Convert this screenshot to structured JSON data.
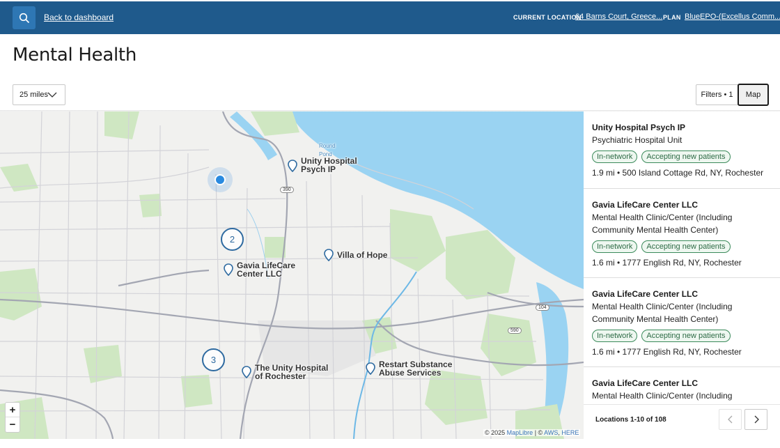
{
  "header": {
    "back_label": "Back to dashboard",
    "current_location_label": "CURRENT LOCATION",
    "current_location_value": "64 Barns Court, Greece...",
    "plan_label": "PLAN",
    "plan_value": "BlueEPO-(Excellus Comm..."
  },
  "page": {
    "title": "Mental Health"
  },
  "controls": {
    "radius": "25 miles",
    "filters": "Filters • 1",
    "map": "Map"
  },
  "map": {
    "labels": {
      "unity_psych": "Unity Hospital Psych IP",
      "villa_hope": "Villa of Hope",
      "gavia": "Gavia LifeCare Center LLC",
      "unity_rochester": "The Unity Hospital of Rochester",
      "restart": "Restart Substance Abuse Services",
      "round_pond": "Round Pond"
    },
    "clusters": [
      "2",
      "3"
    ],
    "shields": [
      "390",
      "104",
      "590"
    ],
    "zoom_in": "+",
    "zoom_out": "−",
    "attribution_a": "© 2025 ",
    "attribution_maplibre": "MapLibre",
    "attribution_b": " | © ",
    "attribution_aws": "AWS",
    "attribution_c": ", ",
    "attribution_here": "HERE",
    "colors": {
      "water": "#9ad3f2",
      "park": "#cfe7c2",
      "road": "#c9c9cf",
      "highway": "#9fa1ad"
    }
  },
  "results": [
    {
      "name": "Unity Hospital Psych IP",
      "type": "Psychiatric Hospital Unit",
      "badges": [
        "In-network",
        "Accepting new patients"
      ],
      "address": "1.9 mi • 500 Island Cottage Rd, NY, Rochester"
    },
    {
      "name": "Gavia LifeCare Center LLC",
      "type": "Mental Health Clinic/Center (Including Community Mental Health Center)",
      "badges": [
        "In-network",
        "Accepting new patients"
      ],
      "address": "1.6 mi • 1777 English Rd, NY, Rochester"
    },
    {
      "name": "Gavia LifeCare Center LLC",
      "type": "Mental Health Clinic/Center (Including Community Mental Health Center)",
      "badges": [
        "In-network",
        "Accepting new patients"
      ],
      "address": "1.6 mi • 1777 English Rd, NY, Rochester"
    },
    {
      "name": "Gavia LifeCare Center LLC",
      "type": "Mental Health Clinic/Center (Including Community",
      "badges": [],
      "address": ""
    }
  ],
  "pagination": {
    "count": "Locations 1-10 of 108"
  }
}
